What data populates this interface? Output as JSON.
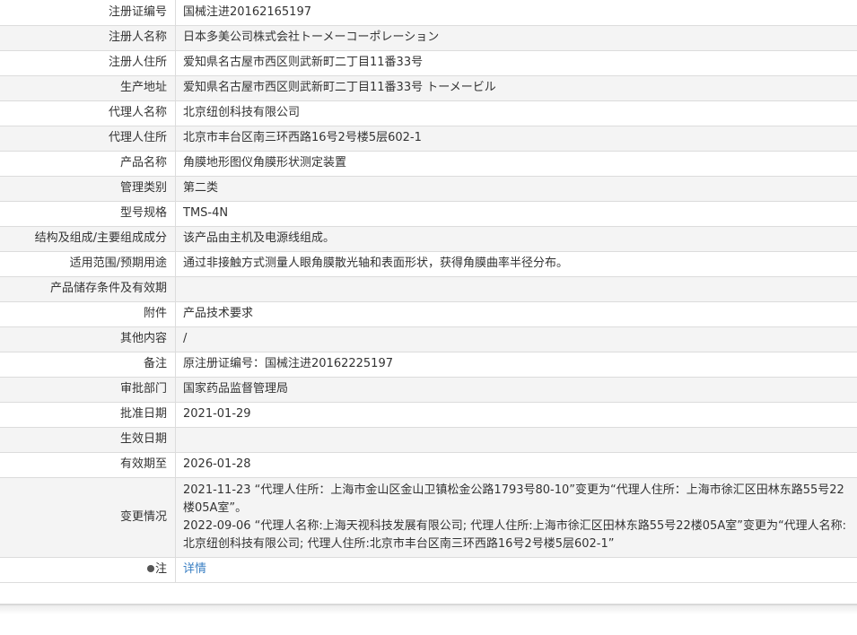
{
  "rows": [
    {
      "label": "注册证编号",
      "value": "国械注进20162165197"
    },
    {
      "label": "注册人名称",
      "value": "日本多美公司株式会社トーメーコーポレーション"
    },
    {
      "label": "注册人住所",
      "value": "爱知県名古屋市西区则武新町二丁目11番33号"
    },
    {
      "label": "生产地址",
      "value": "爱知県名古屋市西区则武新町二丁目11番33号 トーメービル"
    },
    {
      "label": "代理人名称",
      "value": "北京纽创科技有限公司"
    },
    {
      "label": "代理人住所",
      "value": "北京市丰台区南三环西路16号2号楼5层602-1"
    },
    {
      "label": "产品名称",
      "value": "角膜地形图仪角膜形状测定装置"
    },
    {
      "label": "管理类别",
      "value": "第二类"
    },
    {
      "label": "型号规格",
      "value": "TMS-4N"
    },
    {
      "label": "结构及组成/主要组成成分",
      "value": "该产品由主机及电源线组成。"
    },
    {
      "label": "适用范围/预期用途",
      "value": "通过非接触方式测量人眼角膜散光轴和表面形状，获得角膜曲率半径分布。"
    },
    {
      "label": "产品储存条件及有效期",
      "value": ""
    },
    {
      "label": "附件",
      "value": "产品技术要求"
    },
    {
      "label": "其他内容",
      "value": "/"
    },
    {
      "label": "备注",
      "value": "原注册证编号：国械注进20162225197"
    },
    {
      "label": "审批部门",
      "value": "国家药品监督管理局"
    },
    {
      "label": "批准日期",
      "value": "2021-01-29"
    },
    {
      "label": "生效日期",
      "value": ""
    },
    {
      "label": "有效期至",
      "value": "2026-01-28"
    }
  ],
  "changes": {
    "label": "变更情况",
    "entries": [
      "2021-11-23 “代理人住所：上海市金山区金山卫镇松金公路1793号80-10”变更为“代理人住所：上海市徐汇区田林东路55号22楼05A室”。",
      "2022-09-06 “代理人名称:上海天视科技发展有限公司; 代理人住所:上海市徐汇区田林东路55号22楼05A室”变更为“代理人名称:北京纽创科技有限公司; 代理人住所:北京市丰台区南三环西路16号2号楼5层602-1”"
    ]
  },
  "note": {
    "label": "注",
    "icon": "pin-icon",
    "link_text": "详情",
    "link_color": "#3a7fc3"
  }
}
